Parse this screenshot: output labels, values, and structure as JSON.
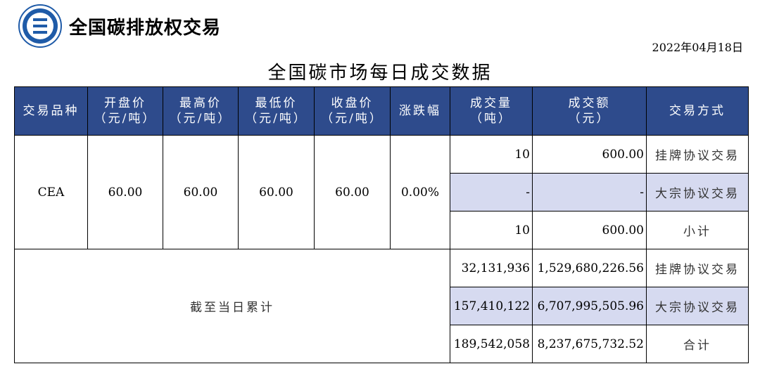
{
  "header": {
    "brand": "全国碳排放权交易",
    "date": "2022年04月18日"
  },
  "title": "全国碳市场每日成交数据",
  "table": {
    "columns": [
      [
        "交易品种"
      ],
      [
        "开盘价",
        "（元/吨）"
      ],
      [
        "最高价",
        "（元/吨）"
      ],
      [
        "最低价",
        "（元/吨）"
      ],
      [
        "收盘价",
        "（元/吨）"
      ],
      [
        "涨跌幅"
      ],
      [
        "成交量",
        "（吨）"
      ],
      [
        "成交额",
        "（元）"
      ],
      [
        "交易方式"
      ]
    ],
    "daily": {
      "product": "CEA",
      "open": "60.00",
      "high": "60.00",
      "low": "60.00",
      "close": "60.00",
      "change": "0.00%",
      "rows": [
        {
          "volume": "10",
          "amount": "600.00",
          "method": "挂牌协议交易"
        },
        {
          "volume": "-",
          "amount": "-",
          "method": "大宗协议交易"
        },
        {
          "volume": "10",
          "amount": "600.00",
          "method": "小计"
        }
      ]
    },
    "cumulative": {
      "label": "截至当日累计",
      "rows": [
        {
          "volume": "32,131,936",
          "amount": "1,529,680,226.56",
          "method": "挂牌协议交易"
        },
        {
          "volume": "157,410,122",
          "amount": "6,707,995,505.96",
          "method": "大宗协议交易"
        },
        {
          "volume": "189,542,058",
          "amount": "8,237,675,732.52",
          "method": "合计"
        }
      ]
    }
  },
  "colors": {
    "header_bg": "#2e4b8c",
    "shade": "#d6daf0",
    "logo_blue": "#1f5ba8"
  }
}
